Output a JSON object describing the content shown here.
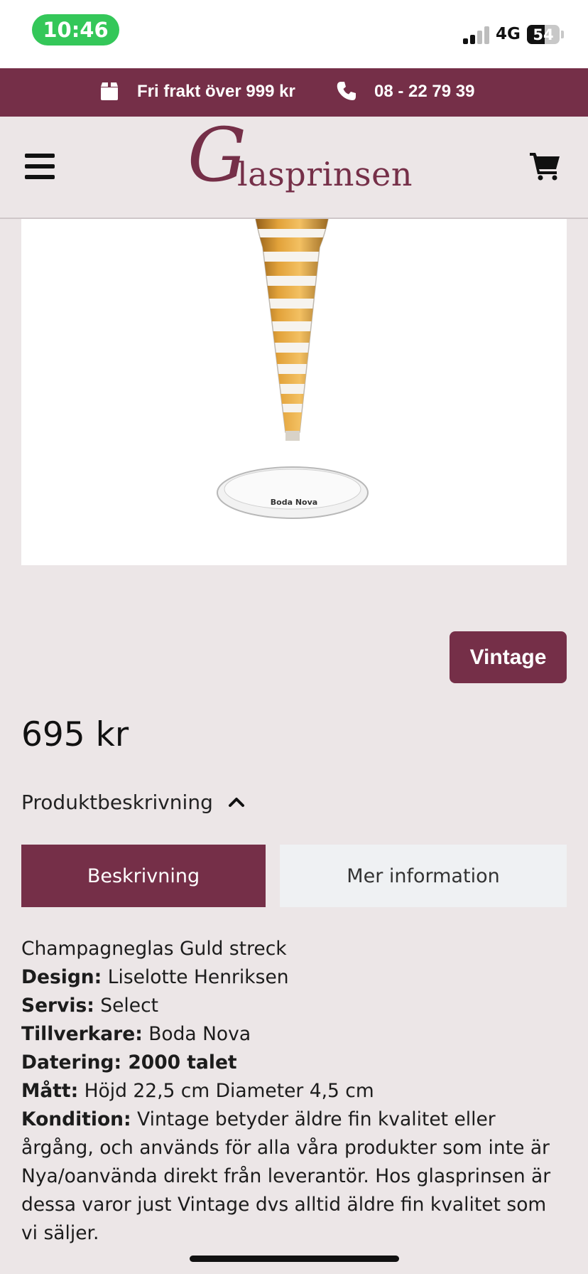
{
  "status_bar": {
    "time": "10:46",
    "network": "4G",
    "battery": "54",
    "battery_level": 0.54
  },
  "promo_bar": {
    "shipping_text": "Fri frakt över 999 kr",
    "phone": "08 - 22 79 39",
    "icons": [
      "box-icon",
      "phone-icon"
    ]
  },
  "header": {
    "logo_initial": "G",
    "logo_rest": "lasprinsen",
    "icons": [
      "menu-icon",
      "cart-icon"
    ]
  },
  "product": {
    "image_brand_text": "Boda Nova",
    "badge": "Vintage",
    "price": "695 kr"
  },
  "accordion": {
    "title": "Produktbeskrivning",
    "icon": "chevron-up-icon"
  },
  "tabs": [
    {
      "label": "Beskrivning",
      "active": true
    },
    {
      "label": "Mer information",
      "active": false
    }
  ],
  "description": {
    "title": "Champagneglas Guld streck",
    "fields": [
      {
        "label": "Design:",
        "value": " Liselotte Henriksen"
      },
      {
        "label": "Servis:",
        "value": " Select"
      },
      {
        "label": "Tillverkare:",
        "value": " Boda Nova"
      },
      {
        "label": "Datering: 2000 talet",
        "value": ""
      },
      {
        "label": "Mått:",
        "value": " Höjd 22,5 cm Diameter 4,5 cm"
      },
      {
        "label": "Kondition:",
        "value": " Vintage betyder äldre fin kvalitet eller årgång, och används för alla våra produkter som inte är Nya/oanvända direkt från leverantör. Hos glasprinsen är dessa varor just Vintage dvs alltid äldre fin kvalitet som vi säljer."
      }
    ]
  },
  "colors": {
    "brand": "#752f48",
    "background": "#ece6e7",
    "status_green": "#34c759",
    "tab_inactive": "#eff1f3"
  }
}
